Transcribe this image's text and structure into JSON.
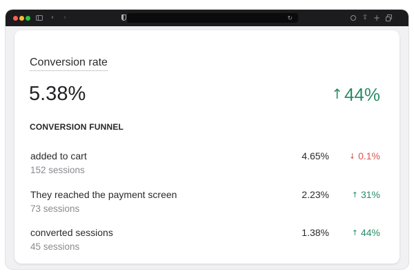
{
  "browser": {
    "icons": {
      "sidebar": "sidebar-icon",
      "back": "chevron-left-icon",
      "forward": "chevron-right-icon",
      "privacy": "shield-icon",
      "reload": "reload-icon",
      "download": "download-icon",
      "share": "share-icon",
      "new_tab": "plus-icon",
      "tabs": "tab-overview-icon"
    },
    "address": ""
  },
  "metric": {
    "title": "Conversion rate",
    "value": "5.38%",
    "change": "44%",
    "change_direction": "up"
  },
  "funnel": {
    "heading": "CONVERSION FUNNEL",
    "rows": [
      {
        "name": "added to cart",
        "sessions": "152 sessions",
        "percent": "4.65%",
        "change": "0.1%",
        "direction": "down"
      },
      {
        "name": "They reached the payment screen",
        "sessions": "73 sessions",
        "percent": "2.23%",
        "change": "31%",
        "direction": "up"
      },
      {
        "name": "converted sessions",
        "sessions": "45 sessions",
        "percent": "1.38%",
        "change": "44%",
        "direction": "up"
      }
    ]
  },
  "colors": {
    "positive": "#2a8c65",
    "negative": "#d9534f",
    "titlebar": "#1c1c1e"
  }
}
